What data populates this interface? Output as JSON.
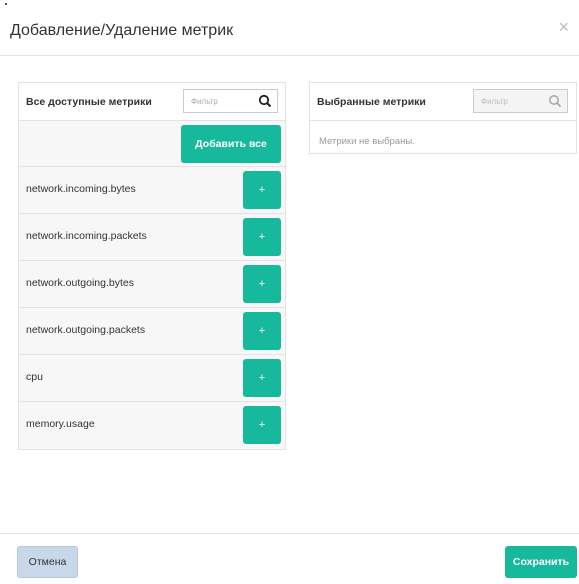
{
  "modal": {
    "title": "Добавление/Удаление метрик",
    "close_symbol": "×"
  },
  "available": {
    "header": "Все доступные метрики",
    "filter_placeholder": "Фильтр",
    "add_all_label": "Добавить все",
    "add_symbol": "+",
    "metrics": [
      "network.incoming.bytes",
      "network.incoming.packets",
      "network.outgoing.bytes",
      "network.outgoing.packets",
      "cpu",
      "memory.usage"
    ]
  },
  "selected": {
    "header": "Выбранные метрики",
    "filter_placeholder": "Фильтр",
    "empty_text": "Метрики не выбраны."
  },
  "footer": {
    "cancel_label": "Отмена",
    "save_label": "Сохранить"
  },
  "colors": {
    "accent": "#17b99d",
    "cancel_bg": "#c9d7ea"
  },
  "icons": {
    "close": "close-icon",
    "search": "search-icon",
    "add": "plus-icon"
  }
}
